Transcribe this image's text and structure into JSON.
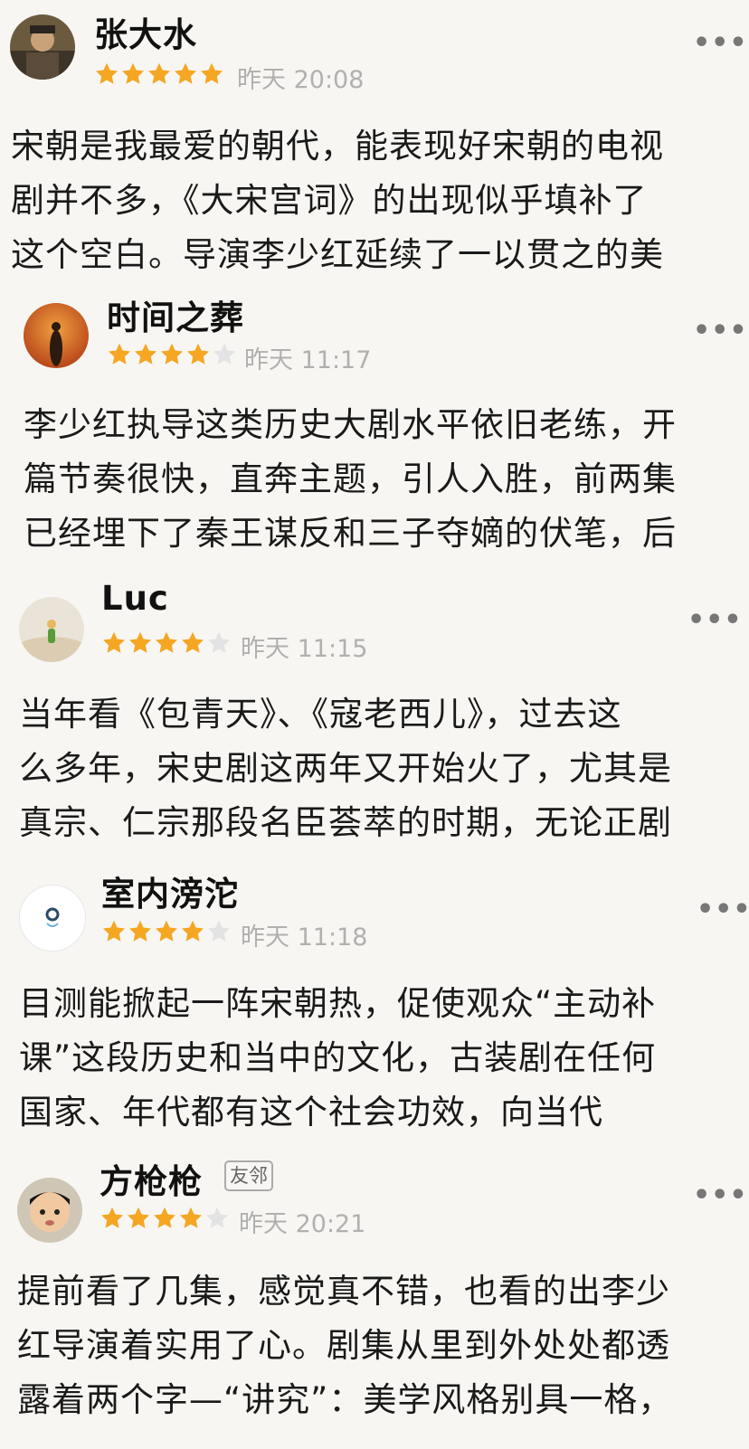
{
  "colors": {
    "background": "#f7f6f2",
    "star_filled": "#f5a623",
    "star_empty": "#e3e3e3",
    "muted": "#b0b0b0"
  },
  "reviews": [
    {
      "user": "张大水",
      "badge": "",
      "rating": 5,
      "time": "昨天 20:08",
      "more_icon": "more-icon",
      "lines": [
        "宋朝是我最爱的朝代，能表现好宋朝的电视",
        "剧并不多，《大宋宫词》的出现似乎填补了",
        "这个空白。导演李少红延续了一以贯之的美"
      ]
    },
    {
      "user": "时间之葬",
      "badge": "",
      "rating": 4,
      "time": "昨天 11:17",
      "more_icon": "more-icon",
      "lines": [
        "李少红执导这类历史大剧水平依旧老练，开",
        "篇节奏很快，直奔主题，引人入胜，前两集",
        "已经埋下了秦王谋反和三子夺嫡的伏笔，后"
      ]
    },
    {
      "user": "Luc",
      "badge": "",
      "rating": 4,
      "time": "昨天 11:15",
      "more_icon": "more-icon",
      "lines": [
        "当年看《包青天》、《寇老西儿》，过去这",
        "么多年，宋史剧这两年又开始火了，尤其是",
        "真宗、仁宗那段名臣荟萃的时期，无论正剧"
      ]
    },
    {
      "user": "室内滂沱",
      "badge": "",
      "rating": 4,
      "time": "昨天 11:18",
      "more_icon": "more-icon",
      "lines": [
        "目测能掀起一阵宋朝热，促使观众“主动补",
        "课”这段历史和当中的文化，古装剧在任何",
        "国家、年代都有这个社会功效，向当代"
      ]
    },
    {
      "user": "方枪枪",
      "badge": "友邻",
      "rating": 4,
      "time": "昨天 20:21",
      "more_icon": "more-icon",
      "lines": [
        "提前看了几集，感觉真不错，也看的出李少",
        "红导演着实用了心。剧集从里到外处处都透",
        "露着两个字—“讲究”：美学风格别具一格，"
      ]
    }
  ]
}
